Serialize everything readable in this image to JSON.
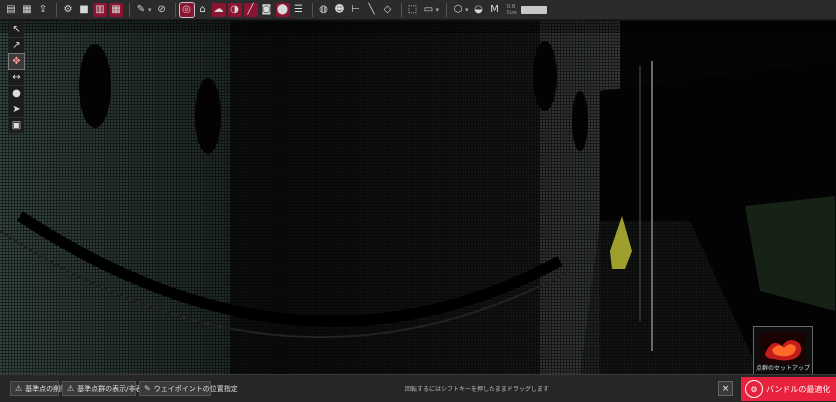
{
  "toolbar": {
    "icons": [
      "open-file",
      "save",
      "export",
      "spacer",
      "settings",
      "layout-single",
      "layout-split",
      "layout-multi",
      "eyedropper",
      "delete",
      "target",
      "tag",
      "cloud",
      "sphere",
      "draw-line",
      "camera",
      "map-pin",
      "layers",
      "globe",
      "user-pin",
      "axes",
      "measure",
      "box-select",
      "cube",
      "display",
      "cube-view",
      "camera-orbit",
      "size-toggle"
    ],
    "size_label_1": "O.B",
    "size_label_2": "Size"
  },
  "left_tools": [
    {
      "name": "select-arrow-icon",
      "glyph": "↖"
    },
    {
      "name": "select-plus-icon",
      "glyph": "↗"
    },
    {
      "name": "move-icon",
      "glyph": "✥",
      "active": true
    },
    {
      "name": "distance-icon",
      "glyph": "↔"
    },
    {
      "name": "user-position-icon",
      "glyph": "●"
    },
    {
      "name": "pointer-icon",
      "glyph": "➤"
    },
    {
      "name": "box-icon",
      "glyph": "▣"
    }
  ],
  "thumbnail": {
    "label": "点群のセットアップ"
  },
  "bottom": {
    "btn_delete": "基準点の削除",
    "btn_toggle": "基準点群の表示/非表示",
    "btn_waypoint": "ウェイポイントの位置指定",
    "hint": "回転するにはシフトキーを押したままドラッグします",
    "close": "×",
    "optimize": "バンドルの最適化"
  },
  "colors": {
    "accent": "#e8223d",
    "toolbar_bg": "#2b2b2b",
    "highlight": "#8b1530"
  }
}
